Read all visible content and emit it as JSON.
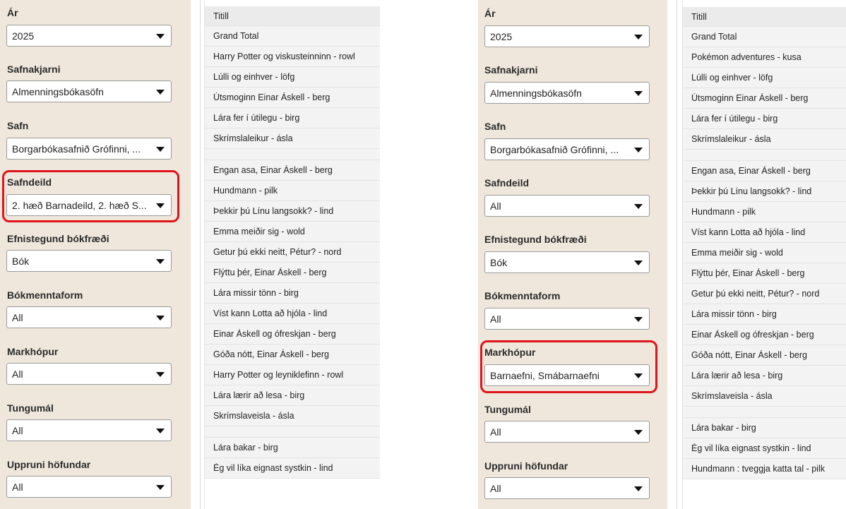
{
  "left": {
    "filters": [
      {
        "label": "Ár",
        "value": "2025"
      },
      {
        "label": "Safnakjarni",
        "value": "Almenningsbókasöfn"
      },
      {
        "label": "Safn",
        "value": "Borgarbókasafnið Grófinni, ..."
      },
      {
        "label": "Safndeild",
        "value": "2. hæð Barnadeild, 2. hæð S..."
      },
      {
        "label": "Efnistegund bókfræði",
        "value": "Bók"
      },
      {
        "label": "Bókmenntaform",
        "value": "All"
      },
      {
        "label": "Markhópur",
        "value": "All"
      },
      {
        "label": "Tungumál",
        "value": "All"
      },
      {
        "label": "Uppruni höfundar",
        "value": "All"
      }
    ],
    "table_header": "Titill",
    "rows": [
      "Grand Total",
      "Harry Potter og viskusteinninn - rowl",
      "Lúlli og einhver - löfg",
      "Útsmoginn Einar Áskell - berg",
      "Lára fer í útilegu - birg",
      "Skrímslaleikur - ásla",
      "",
      "Engan asa, Einar Áskell - berg",
      "Hundmann - pilk",
      "Þekkir þú Línu langsokk? - lind",
      "Emma meiðir sig - wold",
      "Getur þú ekki neitt, Pétur? - nord",
      "Flýttu þér, Einar Áskell - berg",
      "Lára missir tönn - birg",
      "Víst kann Lotta að hjóla - lind",
      "Einar Áskell og ófreskjan - berg",
      "Góða nótt, Einar Áskell - berg",
      "Harry Potter og leyniklefinn - rowl",
      "Lára lærir að lesa - birg",
      "Skrímslaveisla - ásla",
      "",
      "Lára bakar - birg",
      "Ég vil líka eignast systkin - lind"
    ]
  },
  "right": {
    "filters": [
      {
        "label": "Ár",
        "value": "2025"
      },
      {
        "label": "Safnakjarni",
        "value": "Almenningsbókasöfn"
      },
      {
        "label": "Safn",
        "value": "Borgarbókasafnið Grófinni, ..."
      },
      {
        "label": "Safndeild",
        "value": "All"
      },
      {
        "label": "Efnistegund bókfræði",
        "value": "Bók"
      },
      {
        "label": "Bókmenntaform",
        "value": "All"
      },
      {
        "label": "Markhópur",
        "value": "Barnaefni, Smábarnaefni"
      },
      {
        "label": "Tungumál",
        "value": "All"
      },
      {
        "label": "Uppruni höfundar",
        "value": "All"
      }
    ],
    "table_header": "Titill",
    "rows": [
      "Grand Total",
      "Pokémon adventures - kusa",
      "Lúlli og einhver - löfg",
      "Útsmoginn Einar Áskell - berg",
      "Lára fer í útilegu - birg",
      "Skrímslaleikur - ásla",
      "",
      "Engan asa, Einar Áskell - berg",
      "Þekkir þú Línu langsokk? - lind",
      "Hundmann - pilk",
      "Víst kann Lotta að hjóla - lind",
      "Emma meiðir sig - wold",
      "Flýttu þér, Einar Áskell - berg",
      "Getur þú ekki neitt, Pétur? - nord",
      "Lára missir tönn - birg",
      "Einar Áskell og ófreskjan - berg",
      "Góða nótt, Einar Áskell - berg",
      "Lára lærir að lesa - birg",
      "Skrímslaveisla - ásla",
      "",
      "Lára bakar - birg",
      "Ég vil líka eignast systkin - lind",
      "Hundmann : tveggja katta tal - pilk"
    ]
  },
  "colors": {
    "filter_panel_bg": "#efe7dc",
    "highlight_border": "#e0141b",
    "row_bg": "#f3f3f3"
  }
}
